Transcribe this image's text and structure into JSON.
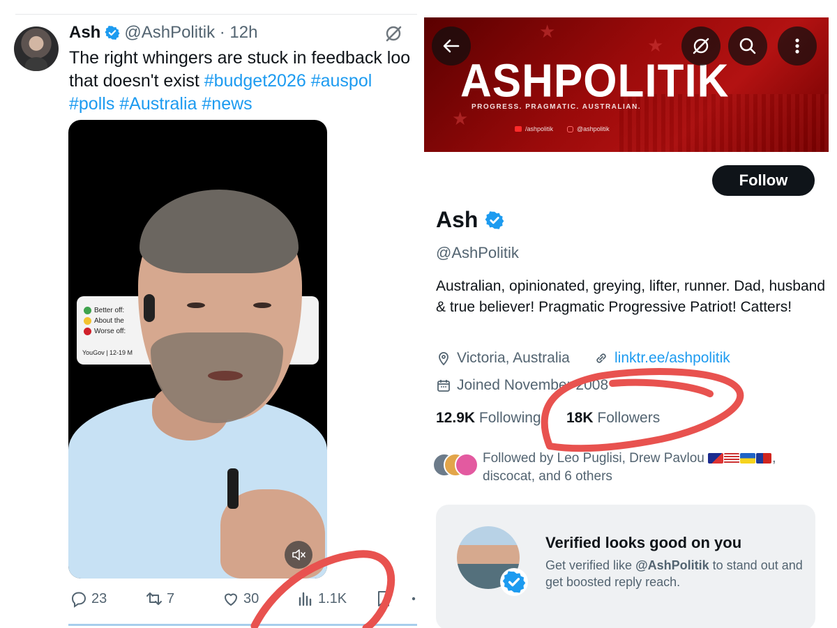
{
  "tweet": {
    "author_name": "Ash",
    "handle_time": "@AshPolitik · 12h",
    "text_line1": "The right whingers are stuck in feedback loo",
    "text_line2_plain": "that doesn't exist ",
    "hashtags_line2": "#budget2026 #auspol",
    "hashtags_line3": "#polls #Australia #news",
    "video_poll": {
      "row1": "Better off: ",
      "row2": "About the ",
      "row3": "Worse off: ",
      "source": "YouGov | 12-19 M",
      "colors": [
        "#3fa34d",
        "#f2c230",
        "#d0202a"
      ]
    },
    "actions": {
      "replies": "23",
      "reposts": "7",
      "likes": "30",
      "views": "1.1K"
    }
  },
  "profile": {
    "banner_title": "ASHPOLITIK",
    "banner_tagline": "PROGRESS. PRAGMATIC. AUSTRALIAN.",
    "banner_youtube": "/ashpolitik",
    "banner_instagram": "@ashpolitik",
    "follow_label": "Follow",
    "name": "Ash",
    "handle": "@AshPolitik",
    "bio": "Australian, opinionated, greying, lifter, runner. Dad, husband & true believer! Pragmatic Progressive Patriot! Catters!",
    "location": "Victoria, Australia",
    "link": "linktr.ee/ashpolitik",
    "joined": "Joined November 2008",
    "following_count": "12.9K",
    "following_label": "Following",
    "followers_count": "18K",
    "followers_label": "Followers",
    "followed_by": "Followed by Leo Puglisi, Drew Pavlou",
    "followed_by_rest": "discocat, and 6 others",
    "promo": {
      "title": "Verified looks good on you",
      "text_prefix": "Get verified like ",
      "text_handle": "@AshPolitik",
      "text_suffix": " to stand out and get boosted reply reach."
    }
  },
  "colors": {
    "accent": "#1d9bf0",
    "text": "#0f1419",
    "muted": "#536471",
    "annotation": "#e8524f",
    "banner_red": "#9a0a0a"
  }
}
